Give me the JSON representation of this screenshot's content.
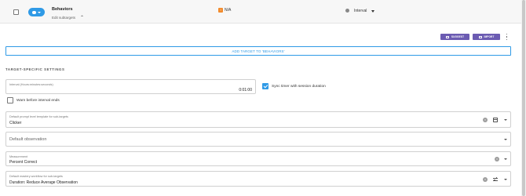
{
  "target_row": {
    "name": "Behaviors",
    "edit_subtargets_label": "Edit subtargets",
    "status_text": "N/A",
    "method_text": "Interval"
  },
  "toolbar": {
    "suggest_label": "SUGGEST",
    "import_label": "IMPORT"
  },
  "add_target_label": "ADD TARGET TO 'BEHAVIORS'",
  "section_title": "TARGET-SPECIFIC SETTINGS",
  "interval_field": {
    "label": "Interval (Hours:minutes:seconds)",
    "value": "0:01:00"
  },
  "sync_timer": {
    "label": "Sync timer with session duration",
    "checked": true
  },
  "warn_before": {
    "label": "Warn before interval ends",
    "checked": false
  },
  "prompt_template": {
    "label": "Default prompt level template for sub-targets",
    "value": "Clicker"
  },
  "observation": {
    "placeholder": "Default observation"
  },
  "measurement": {
    "label": "Measurement",
    "value": "Percent Correct"
  },
  "mastery_workflow": {
    "label": "Default mastery workflow for sub-targets",
    "value": "Duration: Reduce Average Observation"
  },
  "colors": {
    "accent_blue": "#2f9ae6",
    "button_purple": "#6b5bb2",
    "status_orange": "#f28b2c"
  }
}
